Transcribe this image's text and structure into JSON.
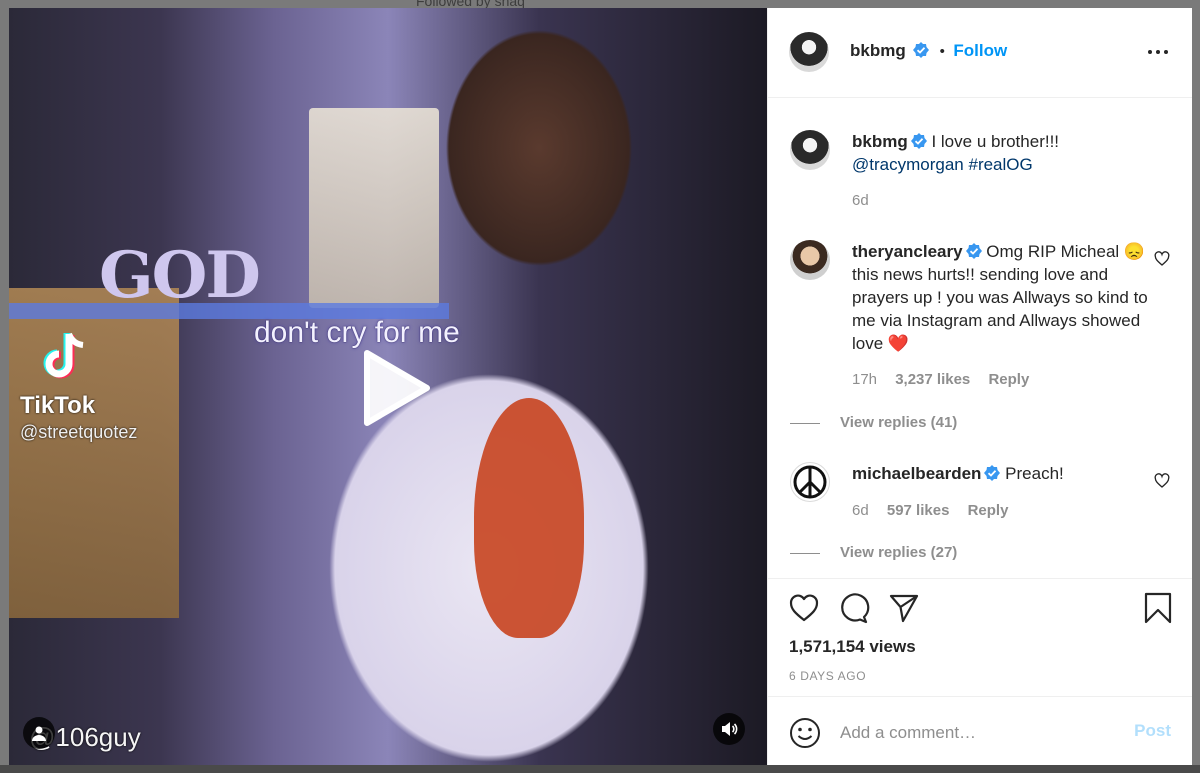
{
  "backdrop": {
    "followed_by_text": "Followed by shaq"
  },
  "video": {
    "overlay_caption": "don't cry for me",
    "background_sign_text": "GOD",
    "tiktok_brand": "TikTok",
    "tiktok_handle": "@streetquotez",
    "user_watermark": "@106guy"
  },
  "header": {
    "username": "bkbmg",
    "separator": "•",
    "follow_label": "Follow"
  },
  "caption": {
    "username": "bkbmg",
    "text_before": " I love u brother!!!",
    "mention": "@tracymorgan",
    "hashtag": "#realOG",
    "time": "6d"
  },
  "comments": [
    {
      "username": "theryancleary",
      "text": " Omg RIP Micheal 😞 this news hurts!! sending love and prayers up ! you was Allways so kind to me via Instagram and Allways showed love ❤️",
      "time": "17h",
      "likes": "3,237 likes",
      "reply_label": "Reply",
      "view_replies": "View replies (41)"
    },
    {
      "username": "michaelbearden",
      "text": " Preach!",
      "time": "6d",
      "likes": "597 likes",
      "reply_label": "Reply",
      "view_replies": "View replies (27)"
    }
  ],
  "stats": {
    "views": "1,571,154 views",
    "date": "6 DAYS AGO"
  },
  "composer": {
    "placeholder": "Add a comment…",
    "post_label": "Post"
  },
  "colors": {
    "accent": "#0095f6",
    "post_disabled": "#b2dffc",
    "muted": "#8e8e8e",
    "heart": "#ed4956",
    "verified": "#3897f0"
  }
}
